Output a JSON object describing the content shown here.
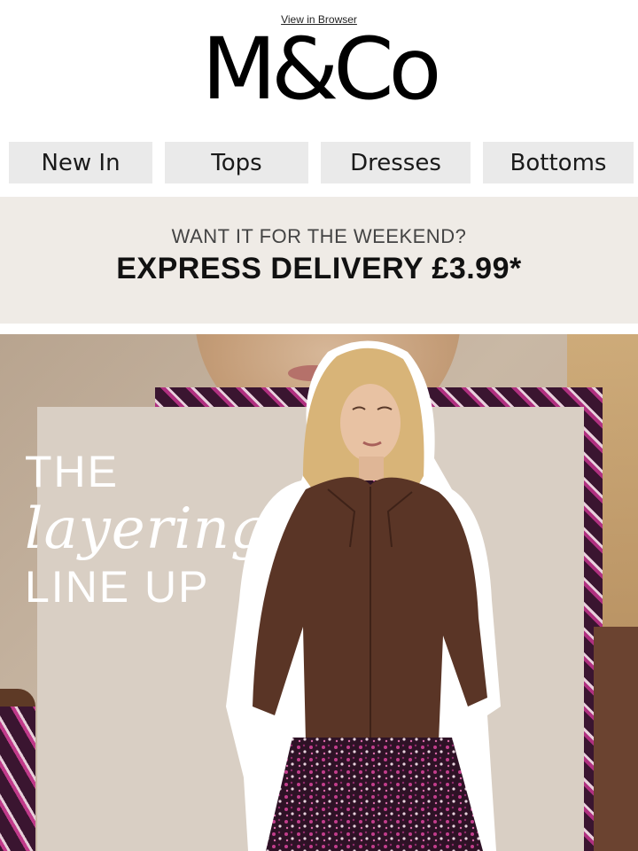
{
  "header": {
    "view_in_browser": "View in Browser",
    "logo_text": "M&Co"
  },
  "nav": {
    "items": [
      {
        "label": "New In"
      },
      {
        "label": "Tops"
      },
      {
        "label": "Dresses"
      },
      {
        "label": "Bottoms"
      }
    ]
  },
  "banner": {
    "line1": "WANT IT FOR THE WEEKEND?",
    "line2": "EXPRESS DELIVERY £3.99*"
  },
  "hero": {
    "title_line1": "THE",
    "title_line2": "layering",
    "title_line3": "LINE UP"
  },
  "colors": {
    "nav_bg": "#eaeaea",
    "banner_bg": "#efebe6",
    "jacket": "#5a3526",
    "floral_dark": "#3a1530",
    "floral_pink": "#c03a8a"
  }
}
